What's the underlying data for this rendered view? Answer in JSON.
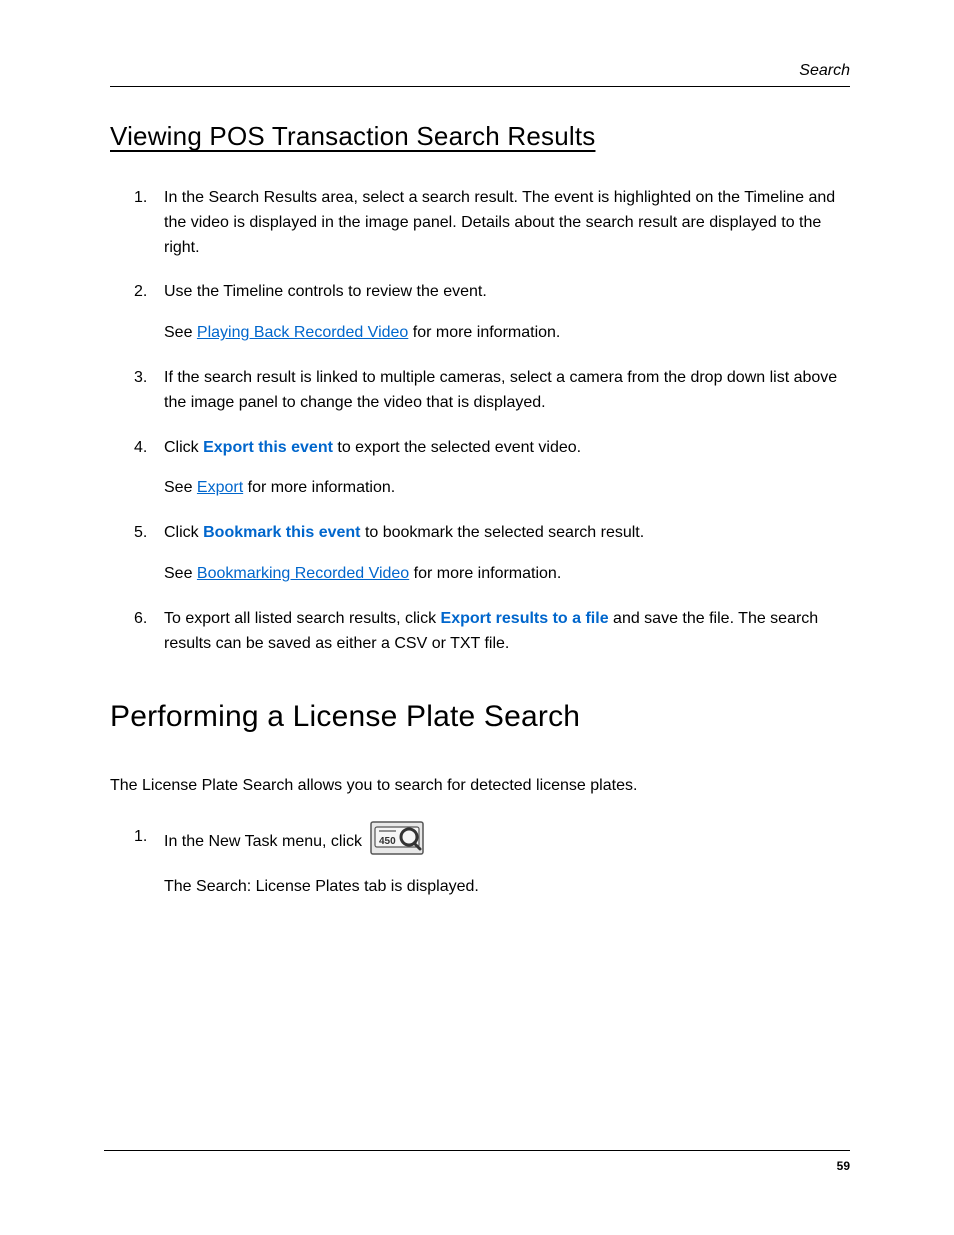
{
  "header": {
    "section": "Search"
  },
  "section1": {
    "title": "Viewing POS Transaction Search Results",
    "steps": [
      {
        "text": "In the Search Results area, select a search result. The event is highlighted on the Timeline and the video is displayed in the image panel. Details about the search result are displayed to the right."
      },
      {
        "text": "Use the Timeline controls to review the event.",
        "sub_prefix": "See ",
        "sub_link": "Playing Back Recorded Video",
        "sub_suffix": " for more information."
      },
      {
        "text": "If the search result is linked to multiple cameras, select a camera from the drop down list above the image panel to change the video that is displayed."
      },
      {
        "prefix": "Click ",
        "ui": "Export this event",
        "suffix": " to export the selected event video.",
        "sub_prefix": "See ",
        "sub_link": "Export",
        "sub_suffix": " for more information."
      },
      {
        "prefix": "Click ",
        "ui": "Bookmark this event",
        "suffix": " to bookmark the selected search result.",
        "sub_prefix": "See ",
        "sub_link": "Bookmarking Recorded Video",
        "sub_suffix": " for more information."
      },
      {
        "prefix": "To export all listed search results, click ",
        "ui": "Export results to a file",
        "suffix": " and save the file. The search results can be saved as either a CSV or TXT file."
      }
    ]
  },
  "section2": {
    "title": "Performing a License Plate Search",
    "intro": "The License Plate Search allows you to search for detected license plates.",
    "steps": [
      {
        "prefix": "In the New Task menu, click ",
        "icon": "license-plate-icon",
        "icon_text": "450",
        "sub_text": "The Search: License Plates tab is displayed."
      }
    ]
  },
  "footer": {
    "page": "59"
  }
}
